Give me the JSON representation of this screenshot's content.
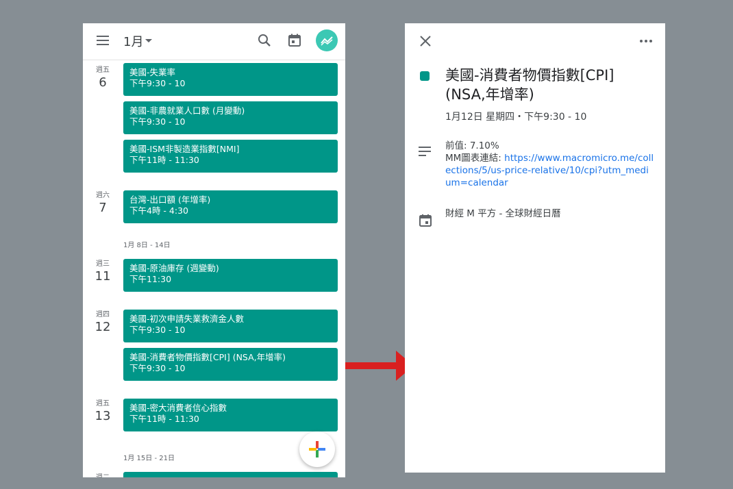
{
  "agenda": {
    "header": {
      "month": "1月",
      "menu_icon": "hamburger-icon",
      "search_icon": "search-icon",
      "today_icon": "calendar-today-icon",
      "avatar_icon": "chart-avatar-icon"
    },
    "days": [
      {
        "dow": "週五",
        "num": "6"
      },
      {
        "dow": "週六",
        "num": "7"
      },
      {
        "dow": "週三",
        "num": "11"
      },
      {
        "dow": "週四",
        "num": "12"
      },
      {
        "dow": "週五",
        "num": "13"
      },
      {
        "dow": "週二",
        "num": ""
      }
    ],
    "weeks": [
      "1月 8日 - 14日",
      "1月 15日 - 21日"
    ],
    "events": [
      {
        "title": "美國-失業率",
        "time": "下午9:30 - 10"
      },
      {
        "title": "美國-非農就業人口數 (月變動)",
        "time": "下午9:30 - 10"
      },
      {
        "title": "美國-ISM非製造業指數[NMI]",
        "time": "下午11時 - 11:30"
      },
      {
        "title": "台灣-出口額 (年增率)",
        "time": "下午4時 - 4:30"
      },
      {
        "title": "美國-原油庫存 (週變動)",
        "time": "下午11:30"
      },
      {
        "title": "美國-初次申請失業救濟金人數",
        "time": "下午9:30 - 10"
      },
      {
        "title": "美國-消費者物價指數[CPI] (NSA,年增率)",
        "time": "下午9:30 - 10"
      },
      {
        "title": "美國-密大消費者信心指數",
        "time": "下午11時 - 11:30"
      },
      {
        "title": "",
        "time": ""
      }
    ],
    "event_color": "#009688",
    "fab_icon": "add-plus-icon"
  },
  "detail": {
    "close_icon": "close-icon",
    "more_icon": "more-horizontal-icon",
    "title": "美國-消費者物價指數[CPI] (NSA,年增率)",
    "datetime": "1月12日 星期四・下午9:30 - 10",
    "previous": "前值: 7.10%",
    "link_label": "MM圖表連結: ",
    "link_url": "https://www.macromicro.me/collections/5/us-price-relative/10/cpi?utm_medium=calendar",
    "calendar_name": "財經 M 平方 - 全球財經日曆",
    "notes_icon": "notes-icon",
    "calendar_icon": "calendar-icon"
  },
  "arrow_color": "#d92020"
}
